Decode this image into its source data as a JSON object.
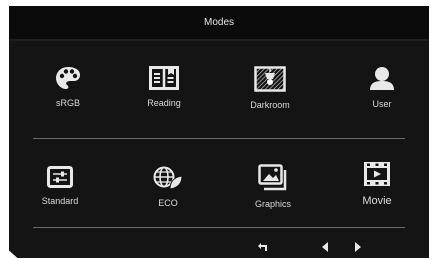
{
  "menu": {
    "title": "Modes",
    "modes": [
      {
        "label": "sRGB",
        "icon": "palette-icon"
      },
      {
        "label": "Reading",
        "icon": "book-icon"
      },
      {
        "label": "Darkroom",
        "icon": "darkroom-lamp-icon"
      },
      {
        "label": "User",
        "icon": "user-icon"
      },
      {
        "label": "Standard",
        "icon": "sliders-icon"
      },
      {
        "label": "ECO",
        "icon": "eco-globe-leaf-icon"
      },
      {
        "label": "Graphics",
        "icon": "images-icon"
      },
      {
        "label": "Movie",
        "icon": "film-play-icon"
      }
    ]
  },
  "nav": {
    "icons": [
      "return-icon",
      "arrow-left-icon",
      "arrow-right-icon"
    ]
  },
  "colors": {
    "background": "#141414",
    "title_bar": "#0b0b0b",
    "text": "#d9d9d9",
    "divider": "#6a6a6a"
  }
}
